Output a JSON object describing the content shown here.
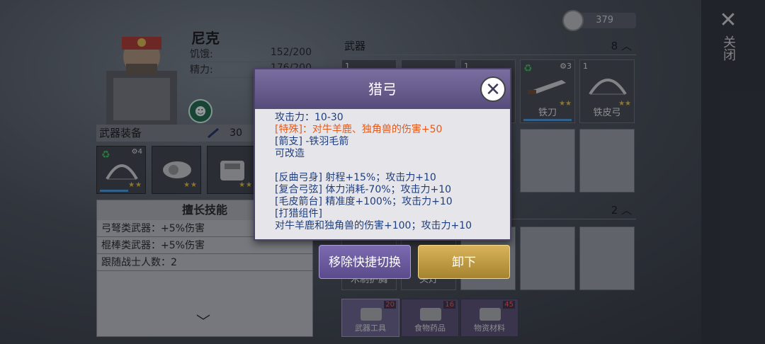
{
  "character": {
    "name": "尼克",
    "stats": [
      {
        "label": "饥饿:",
        "value": "152/200"
      },
      {
        "label": "精力:",
        "value": "176/200"
      }
    ]
  },
  "weapon_equip": {
    "title": "武器装备",
    "power": "30",
    "slots": [
      {
        "level": "4",
        "stars": "★★"
      },
      {
        "stars": "★★"
      },
      {
        "stars": "★★"
      }
    ]
  },
  "skills": {
    "title": "擅长技能",
    "items": [
      "弓弩类武器：+5%伤害",
      "棍棒类武器：+5%伤害",
      "跟随战士人数：2"
    ]
  },
  "currency": {
    "value": "379"
  },
  "inventory": {
    "weapons_header": "武器",
    "weapons_count": "8",
    "second_count": "2",
    "slots": [
      {
        "num": "1",
        "level": "3",
        "label": "铁刀",
        "stars": "★★"
      },
      {
        "num": "1",
        "label": "铁皮弓",
        "stars": "★★"
      }
    ],
    "partial_labels": [
      "木制护胸",
      "头灯"
    ],
    "categories": [
      {
        "label": "武器工具",
        "count": "20"
      },
      {
        "label": "食物药品",
        "count": "16"
      },
      {
        "label": "物资材料",
        "count": "45"
      }
    ]
  },
  "close": {
    "label": "关闭"
  },
  "popup": {
    "title": "猎弓",
    "lines": {
      "attack": "攻击力：10-30",
      "special": "[特殊]：对牛羊鹿、独角兽的伤害+50",
      "branch": "[箭支] -铁羽毛箭",
      "modifiable": "可改造",
      "mod1": "[反曲弓身] 射程+15%；攻击力+10",
      "mod2": "[复合弓弦] 体力消耗-70%；攻击力+10",
      "mod3": "[毛皮箭台] 精准度+100%；攻击力+10",
      "mod4": "[打猎组件]",
      "mod5": "对牛羊鹿和独角兽的伤害+100；攻击力+10"
    },
    "buttons": {
      "remove_shortcut": "移除快捷切换",
      "unequip": "卸下"
    }
  },
  "colors": {
    "popup_header": "#6e6398",
    "special_text": "#e35a1a",
    "desc_text": "#1f3e7d",
    "gold_button": "#c9a24a"
  }
}
